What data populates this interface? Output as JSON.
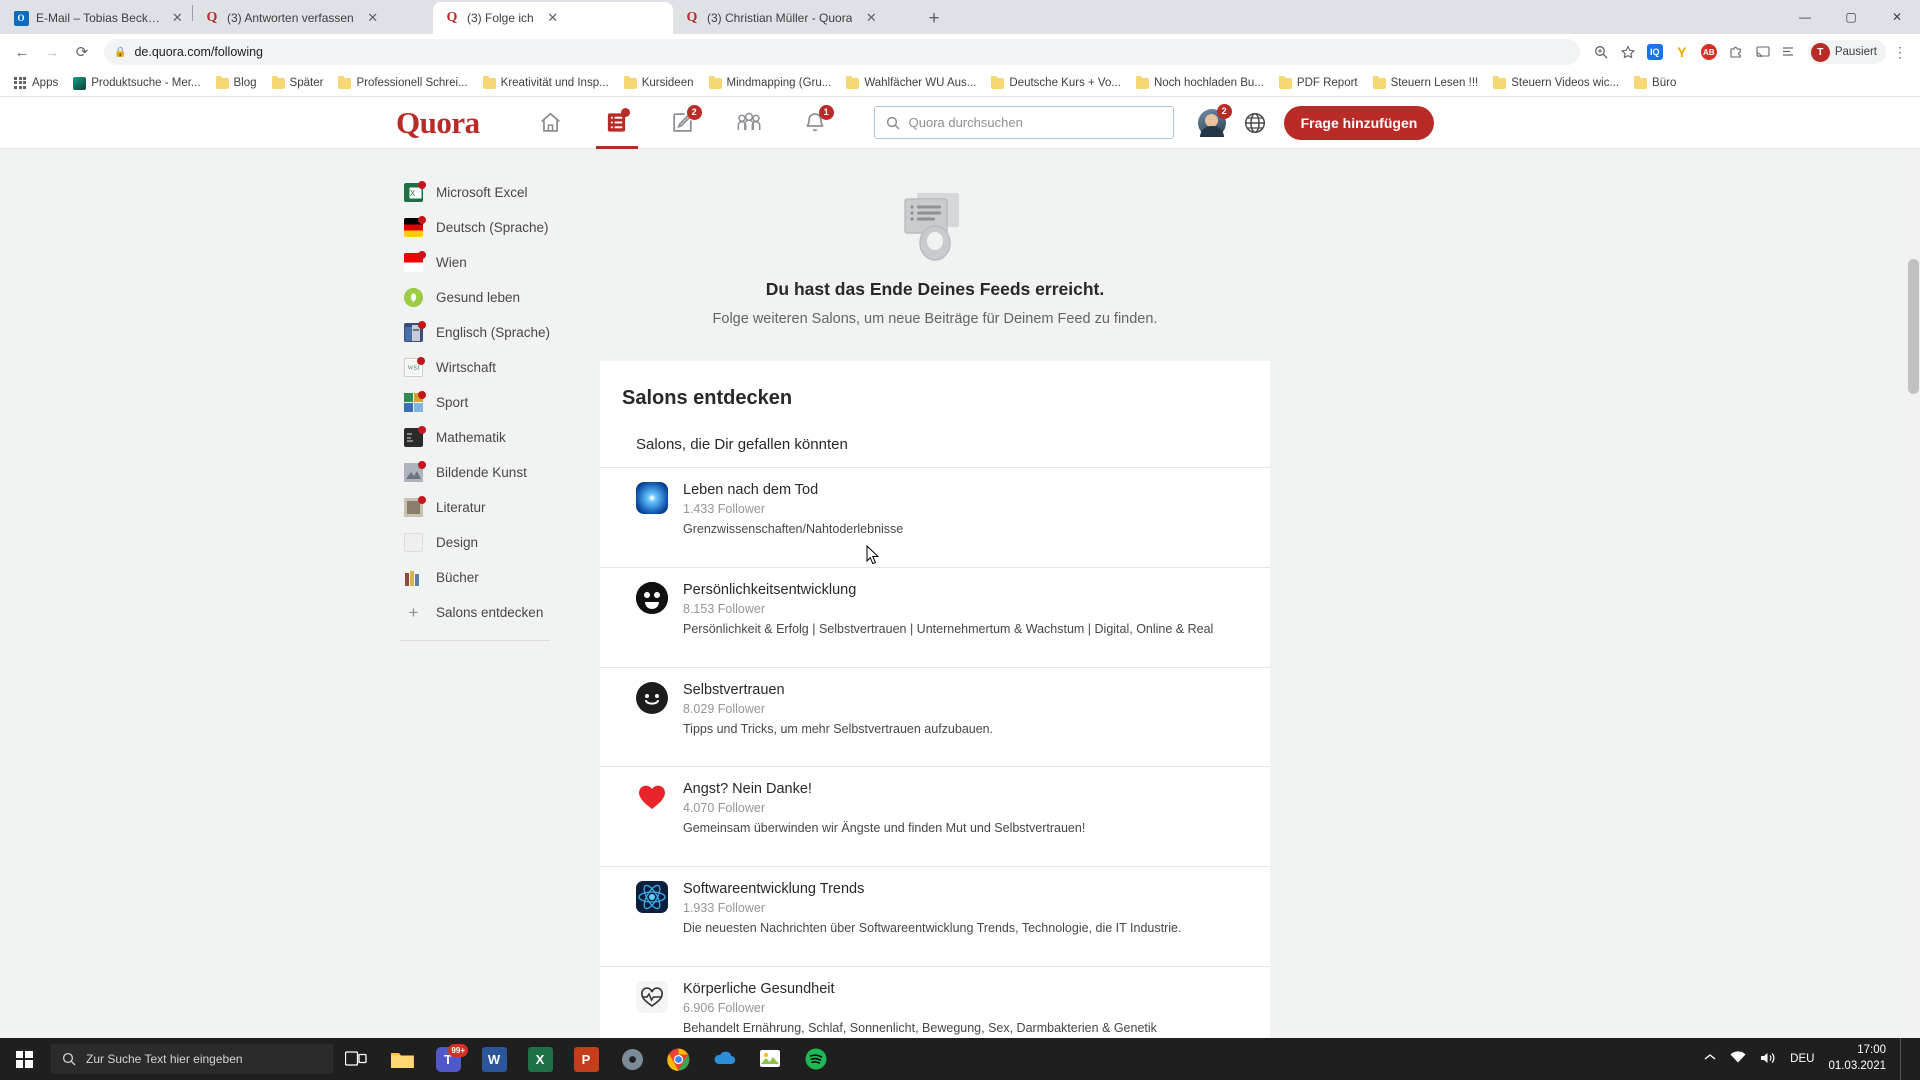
{
  "browser": {
    "tabs": [
      {
        "icon": "outlook-icon",
        "title": "E-Mail – Tobias Becker – Outlook",
        "active": false
      },
      {
        "icon": "quora-icon",
        "title": "(3) Antworten verfassen",
        "active": false
      },
      {
        "icon": "quora-icon",
        "title": "(3) Folge ich",
        "active": true
      },
      {
        "icon": "quora-icon",
        "title": "(3) Christian Müller - Quora",
        "active": false
      }
    ],
    "new_tab_label": "+",
    "close_label": "✕",
    "window_controls": {
      "minimize": "—",
      "maximize": "▢",
      "close": "✕"
    },
    "nav": {
      "back": "←",
      "forward": "→",
      "reload": "⟳"
    },
    "omnibox": {
      "url": "de.quora.com/following",
      "lock_icon": "lock-icon"
    },
    "toolbar_icons": [
      "zoom-in-icon",
      "bookmark-star-icon",
      "iq-extension-icon",
      "yandex-extension-icon",
      "adblock-extension-icon",
      "puzzle-extension-icon",
      "cast-icon",
      "reading-list-icon"
    ],
    "profile": {
      "initial": "T",
      "label": "Pausiert"
    },
    "menu_label": "⋮",
    "bookmarks": [
      {
        "icon": "apps-grid-icon",
        "label": "Apps"
      },
      {
        "icon": "site-icon",
        "label": "Produktsuche - Mer..."
      },
      {
        "icon": "folder-icon",
        "label": "Blog"
      },
      {
        "icon": "folder-icon",
        "label": "Später"
      },
      {
        "icon": "folder-icon",
        "label": "Professionell Schrei..."
      },
      {
        "icon": "folder-icon",
        "label": "Kreativität und Insp..."
      },
      {
        "icon": "folder-icon",
        "label": "Kursideen"
      },
      {
        "icon": "folder-icon",
        "label": "Mindmapping (Gru..."
      },
      {
        "icon": "folder-icon",
        "label": "Wahlfächer WU Aus..."
      },
      {
        "icon": "folder-icon",
        "label": "Deutsche Kurs + Vo..."
      },
      {
        "icon": "folder-icon",
        "label": "Noch hochladen Bu..."
      },
      {
        "icon": "folder-icon",
        "label": "PDF Report"
      },
      {
        "icon": "folder-icon",
        "label": "Steuern Lesen !!!"
      },
      {
        "icon": "folder-icon",
        "label": "Steuern Videos wic..."
      },
      {
        "icon": "folder-icon",
        "label": "Büro"
      }
    ]
  },
  "quora": {
    "logo": "Quora",
    "accent_color": "#b92b27",
    "nav": [
      {
        "name": "home-icon",
        "badge": null,
        "selected": false
      },
      {
        "name": "feed-icon",
        "badge": "dot",
        "selected": true
      },
      {
        "name": "answer-icon",
        "badge": "2",
        "selected": false
      },
      {
        "name": "spaces-icon",
        "badge": null,
        "selected": false
      },
      {
        "name": "notifications-bell-icon",
        "badge": "1",
        "selected": false
      }
    ],
    "search_placeholder": "Quora durchsuchen",
    "avatar_badge": "2",
    "language_icon": "globe-icon",
    "add_question_label": "Frage hinzufügen"
  },
  "sidebar": {
    "items": [
      {
        "label": "Microsoft Excel",
        "icon": "excel-icon",
        "dot": true
      },
      {
        "label": "Deutsch (Sprache)",
        "icon": "german-flag-icon",
        "dot": true
      },
      {
        "label": "Wien",
        "icon": "vienna-flag-icon",
        "dot": true
      },
      {
        "label": "Gesund leben",
        "icon": "health-leaf-icon",
        "dot": false
      },
      {
        "label": "Englisch (Sprache)",
        "icon": "books-icon",
        "dot": true
      },
      {
        "label": "Wirtschaft",
        "icon": "economy-icon",
        "dot": true
      },
      {
        "label": "Sport",
        "icon": "sport-icon",
        "dot": true
      },
      {
        "label": "Mathematik",
        "icon": "math-icon",
        "dot": true
      },
      {
        "label": "Bildende Kunst",
        "icon": "art-icon",
        "dot": true
      },
      {
        "label": "Literatur",
        "icon": "literature-icon",
        "dot": true
      },
      {
        "label": "Design",
        "icon": "design-icon",
        "dot": false
      },
      {
        "label": "Bücher",
        "icon": "books-stack-icon",
        "dot": false
      }
    ],
    "discover_label": "Salons entdecken",
    "discover_icon": "plus-icon"
  },
  "feed_end": {
    "icon": "empty-feed-icon",
    "title": "Du hast das Ende Deines Feeds erreicht.",
    "subtitle": "Folge weiteren Salons, um neue Beiträge für Deinem Feed zu finden."
  },
  "discover_card": {
    "heading": "Salons entdecken",
    "subheading": "Salons, die Dir gefallen könnten",
    "salons": [
      {
        "name": "Leben nach dem Tod",
        "followers": "1.433 Follower",
        "description": "Grenzwissenschaften/Nahtoderlebnisse",
        "avatar_color": "#1b6fd4"
      },
      {
        "name": "Persönlichkeitsentwicklung",
        "followers": "8.153 Follower",
        "description": "Persönlichkeit & Erfolg | Selbstvertrauen | Unternehmertum & Wachstum | Digital, Online & Real",
        "avatar_color": "#111111"
      },
      {
        "name": "Selbstvertrauen",
        "followers": "8.029 Follower",
        "description": "Tipps und Tricks, um mehr Selbstvertrauen aufzubauen.",
        "avatar_color": "#1c1c1c"
      },
      {
        "name": "Angst? Nein Danke!",
        "followers": "4.070 Follower",
        "description": "Gemeinsam überwinden wir Ängste und finden Mut und Selbstvertrauen!",
        "avatar_color": "#e02020"
      },
      {
        "name": "Softwareentwicklung Trends",
        "followers": "1.933 Follower",
        "description": "Die neuesten Nachrichten über Softwareentwicklung Trends, Technologie, die IT Industrie.",
        "avatar_color": "#16325c"
      },
      {
        "name": "Körperliche Gesundheit",
        "followers": "6.906 Follower",
        "description": "Behandelt Ernährung, Schlaf, Sonnenlicht, Bewegung, Sex, Darmbakterien & Genetik",
        "avatar_color": "#f2f2f2"
      }
    ]
  },
  "taskbar": {
    "start_icon": "windows-start-icon",
    "search_placeholder": "Zur Suche Text hier eingeben",
    "search_icon": "search-icon",
    "taskview_icon": "task-view-icon",
    "apps": [
      {
        "name": "file-explorer-icon",
        "label": "",
        "badge": null
      },
      {
        "name": "teams-icon",
        "label": "",
        "badge": "99+"
      },
      {
        "name": "word-icon",
        "label": "W",
        "badge": null
      },
      {
        "name": "excel-icon",
        "label": "X",
        "badge": null
      },
      {
        "name": "powerpoint-icon",
        "label": "P",
        "badge": null
      },
      {
        "name": "disc-icon",
        "label": "",
        "badge": null
      },
      {
        "name": "chrome-icon",
        "label": "",
        "badge": null
      },
      {
        "name": "onedrive-icon",
        "label": "",
        "badge": null
      },
      {
        "name": "photos-icon",
        "label": "",
        "badge": null
      },
      {
        "name": "spotify-icon",
        "label": "",
        "badge": null
      }
    ],
    "tray": {
      "expand_icon": "chevron-up-icon",
      "network_icon": "network-icon",
      "volume_icon": "volume-icon",
      "language": "DEU",
      "time": "17:00",
      "date": "01.03.2021"
    }
  }
}
